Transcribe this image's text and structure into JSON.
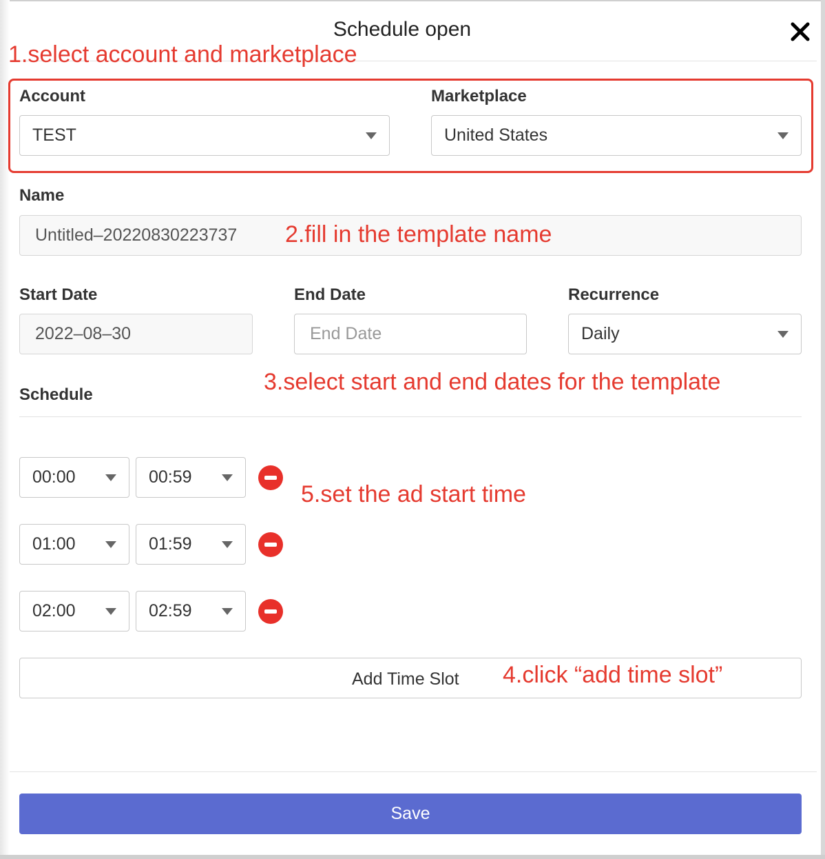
{
  "dialog": {
    "title": "Schedule open",
    "close_icon": "close-icon",
    "save_label": "Save"
  },
  "account": {
    "label": "Account",
    "value": "TEST"
  },
  "marketplace": {
    "label": "Marketplace",
    "value": "United States"
  },
  "name": {
    "label": "Name",
    "value": "Untitled–20220830223737"
  },
  "start_date": {
    "label": "Start Date",
    "value": "2022–08–30"
  },
  "end_date": {
    "label": "End Date",
    "placeholder": "End Date"
  },
  "recurrence": {
    "label": "Recurrence",
    "value": "Daily"
  },
  "schedule": {
    "label": "Schedule",
    "slots": [
      {
        "start": "00:00",
        "end": "00:59"
      },
      {
        "start": "01:00",
        "end": "01:59"
      },
      {
        "start": "02:00",
        "end": "02:59"
      }
    ],
    "add_label": "Add Time Slot",
    "remove_icon": "minus-circle-icon"
  },
  "annotations": {
    "step1": "1.select account and marketplace",
    "step2": "2.fill in the template name",
    "step3": "3.select start and end dates for the template",
    "step4": "4.click “add time slot”",
    "step5": "5.set the ad start time",
    "color": "#e53a2f"
  },
  "colors": {
    "primary": "#5b6bd0",
    "danger": "#e8302a"
  }
}
